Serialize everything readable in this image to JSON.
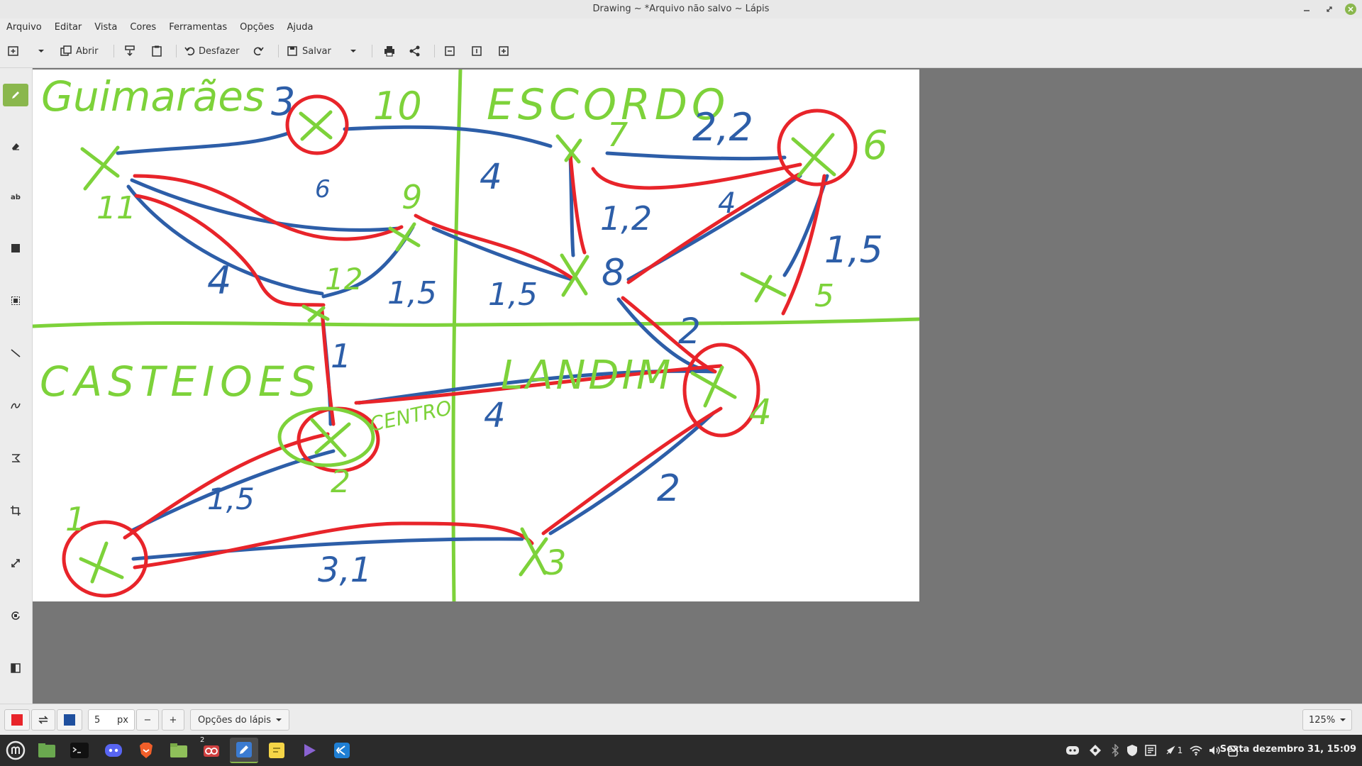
{
  "window": {
    "title": "Drawing ~ *Arquivo não salvo ~ Lápis"
  },
  "menu": [
    "Arquivo",
    "Editar",
    "Vista",
    "Cores",
    "Ferramentas",
    "Opções",
    "Ajuda"
  ],
  "toolbar": {
    "open_label": "Abrir",
    "undo_label": "Desfazer",
    "save_label": "Salvar"
  },
  "tools": {
    "text_tool_label": "ab"
  },
  "options": {
    "primary_color": "#e8242a",
    "secondary_color": "#1e4f9e",
    "size_value": "5",
    "size_unit": "px",
    "decrease": "−",
    "increase": "+",
    "pencil_options_label": "Opções do lápis",
    "zoom_label": "125%"
  },
  "drawing": {
    "regions": [
      "Guimarães",
      "ESCORDO",
      "CASTEIOES",
      "LANDIM"
    ],
    "region_text": [
      "Guimarães",
      "ESCORDO",
      "CASTEIOES",
      "LANDIM"
    ],
    "node_labels": [
      "10",
      "7",
      "11",
      "9",
      "12",
      "8",
      "6",
      "5",
      "CENTRO",
      "4",
      "1",
      "2",
      "3"
    ],
    "edge_labels": [
      "3",
      "2,2",
      "6",
      "4",
      "1,2",
      "4",
      "4",
      "1,5",
      "1,5",
      "1,5",
      "2",
      "1",
      "4",
      "1,5",
      "2",
      "3,1"
    ]
  },
  "taskbar": {
    "notification_count": "2",
    "tray_count": "1",
    "clock": "Sexta dezembro 31, 15:09"
  },
  "colors": {
    "green": "#7dd23a",
    "red": "#e8242a",
    "blue": "#2d5ea8",
    "accent": "#8ab74d"
  }
}
